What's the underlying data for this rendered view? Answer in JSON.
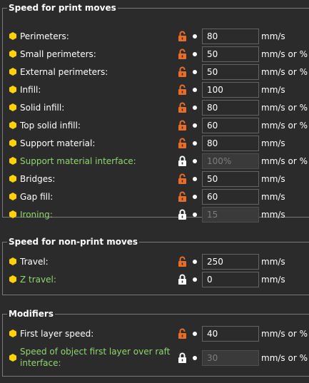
{
  "groups": [
    {
      "title": "Speed for print moves",
      "rows": [
        {
          "label": "Perimeters:",
          "value": "80",
          "unit": "mm/s",
          "lock": "unlocked",
          "disabled": false,
          "green": false
        },
        {
          "label": "Small perimeters:",
          "value": "50",
          "unit": "mm/s or %",
          "lock": "unlocked",
          "disabled": false,
          "green": false
        },
        {
          "label": "External perimeters:",
          "value": "50",
          "unit": "mm/s or %",
          "lock": "unlocked",
          "disabled": false,
          "green": false
        },
        {
          "label": "Infill:",
          "value": "100",
          "unit": "mm/s",
          "lock": "unlocked",
          "disabled": false,
          "green": false
        },
        {
          "label": "Solid infill:",
          "value": "80",
          "unit": "mm/s or %",
          "lock": "unlocked",
          "disabled": false,
          "green": false
        },
        {
          "label": "Top solid infill:",
          "value": "60",
          "unit": "mm/s or %",
          "lock": "unlocked",
          "disabled": false,
          "green": false
        },
        {
          "label": "Support material:",
          "value": "80",
          "unit": "mm/s",
          "lock": "unlocked",
          "disabled": false,
          "green": false
        },
        {
          "label": "Support material interface:",
          "value": "100%",
          "unit": "mm/s or %",
          "lock": "locked",
          "disabled": true,
          "green": true
        },
        {
          "label": "Bridges:",
          "value": "50",
          "unit": "mm/s",
          "lock": "unlocked",
          "disabled": false,
          "green": false
        },
        {
          "label": "Gap fill:",
          "value": "60",
          "unit": "mm/s",
          "lock": "unlocked",
          "disabled": false,
          "green": false
        },
        {
          "label": "Ironing:",
          "value": "15",
          "unit": "mm/s",
          "lock": "locked",
          "disabled": true,
          "green": true
        }
      ]
    },
    {
      "title": "Speed for non-print moves",
      "rows": [
        {
          "label": "Travel:",
          "value": "250",
          "unit": "mm/s",
          "lock": "unlocked",
          "disabled": false,
          "green": false
        },
        {
          "label": "Z travel:",
          "value": "0",
          "unit": "mm/s",
          "lock": "locked",
          "disabled": false,
          "green": true
        }
      ]
    },
    {
      "title": "Modifiers",
      "rows": [
        {
          "label": "First layer speed:",
          "value": "40",
          "unit": "mm/s or %",
          "lock": "unlocked",
          "disabled": false,
          "green": false
        },
        {
          "label": "Speed of object first layer over raft interface:",
          "value": "30",
          "unit": "mm/s or %",
          "lock": "locked",
          "disabled": true,
          "green": true
        }
      ]
    }
  ],
  "colors": {
    "background": "#2b2b2b",
    "unlocked_lock": "#e86d2b",
    "locked_lock": "#ffffff",
    "bullet": "#ffd200",
    "green_label": "#8fd66e"
  },
  "icons": {
    "bullet": "yellow-hexagon-icon",
    "unlocked": "unlocked-padlock-icon",
    "locked": "locked-padlock-icon",
    "dot": "white-dot-icon"
  }
}
